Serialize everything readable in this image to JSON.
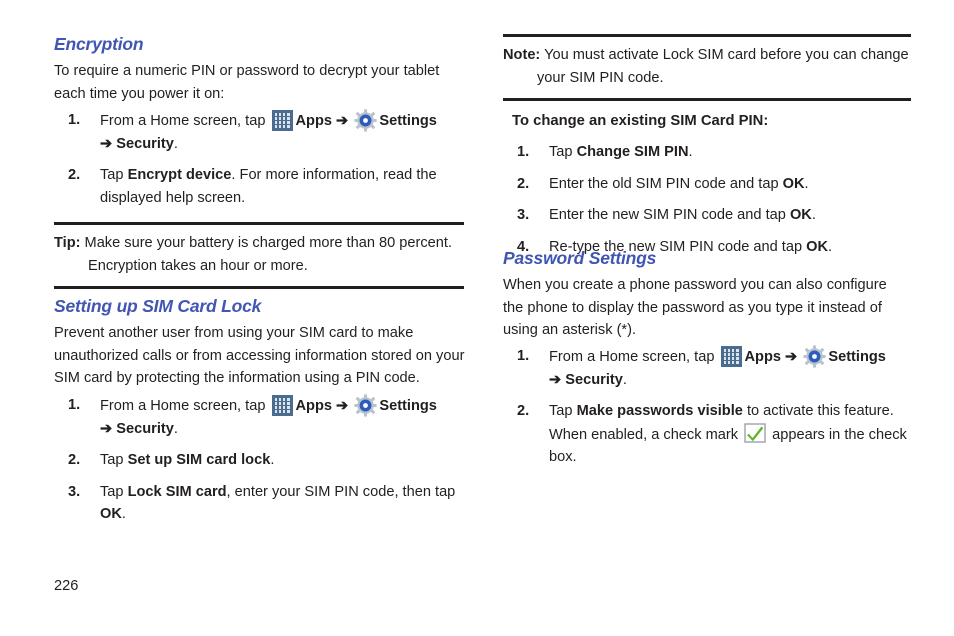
{
  "page": {
    "number": "226"
  },
  "icons": {
    "apps": "apps-grid-icon",
    "settings": "settings-gear-icon",
    "checkmark": "green-checkmark-icon",
    "arrow": "➔"
  },
  "colors": {
    "heading": "#4055b4",
    "body": "#231f20",
    "apps_icon_bg": "#4a6c8f",
    "apps_icon_cell": "#dbe4ec",
    "gear_ring": "#2d5bbf",
    "gear_body": "#b9c3cc",
    "check_green": "#5fb52a"
  },
  "left_column": {
    "heading": "Encryption",
    "intro": "To require a numeric PIN or password to decrypt your tablet each time you power it on:",
    "steps": [
      {
        "num": "1.",
        "pre": "From a Home screen, tap ",
        "apps_label": "Apps",
        "settings_label": "Settings",
        "cont_arrow": "➔",
        "cont_bold": "Security",
        "cont_after": "."
      },
      {
        "num": "2.",
        "pre": "Tap ",
        "bold": "Encrypt device",
        "post": ". For more information, read the displayed help screen."
      }
    ],
    "tip": {
      "label": "Tip:",
      "text": " Make sure your battery is charged more than 80 percent. Encryption takes an hour or more."
    },
    "sim_heading": "Setting up SIM Card Lock",
    "sim_intro": "Prevent another user from using your SIM card to make unauthorized calls or from accessing information stored on your SIM card by protecting the information using a PIN code.",
    "sim_steps": [
      {
        "num": "1.",
        "pre": "From a Home screen, tap ",
        "apps_label": "Apps",
        "settings_label": "Settings",
        "cont_arrow": "➔",
        "cont_bold": "Security",
        "cont_after": "."
      },
      {
        "num": "2.",
        "pre": "Tap ",
        "bold": "Set up SIM card lock",
        "post": "."
      },
      {
        "num": "3.",
        "pre": "Tap ",
        "bold": "Lock SIM card",
        "post": ", enter your SIM PIN code, then tap ",
        "bold2": "OK",
        "post2": "."
      }
    ]
  },
  "right_column": {
    "note": {
      "label": "Note:",
      "text": " You must activate Lock SIM card before you can change your SIM PIN code."
    },
    "subhead": "To change an existing SIM Card PIN:",
    "pin_steps": [
      {
        "num": "1.",
        "pre": "Tap ",
        "bold": "Change SIM PIN",
        "post": "."
      },
      {
        "num": "2.",
        "pre": "Enter the old SIM PIN code and tap ",
        "bold": "OK",
        "post": "."
      },
      {
        "num": "3.",
        "pre": "Enter the new SIM PIN code and tap ",
        "bold": "OK",
        "post": "."
      },
      {
        "num": "4.",
        "pre": "Re-type the new SIM PIN code and tap ",
        "bold": "OK",
        "post": "."
      }
    ],
    "heading": "Password Settings",
    "intro": "When you create a phone password you can also configure the phone to display the password as you type it instead of using an asterisk (*).",
    "steps": [
      {
        "num": "1.",
        "pre": "From a Home screen, tap ",
        "apps_label": "Apps",
        "settings_label": "Settings",
        "cont_arrow": "➔",
        "cont_bold": "Security",
        "cont_after": "."
      },
      {
        "num": "2.",
        "pre": "Tap ",
        "bold": "Make passwords visible",
        "post": " to activate this feature. When enabled, a check mark ",
        "post2": " appears in the check box."
      }
    ]
  }
}
